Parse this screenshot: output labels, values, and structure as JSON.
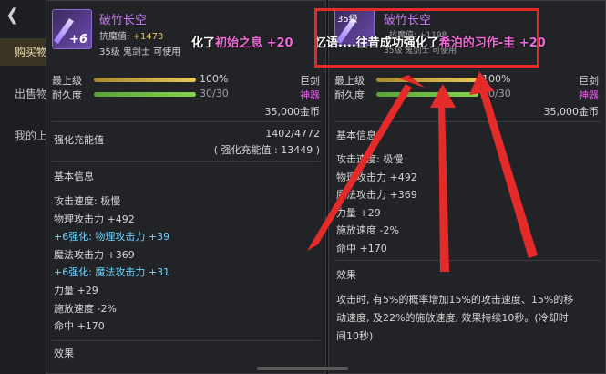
{
  "background": {
    "back_icon": "back-arrow-icon",
    "nav": [
      "购买物",
      "出售物",
      "我的上"
    ]
  },
  "left_panel": {
    "item_name": "破竹长空",
    "enhance": "+6",
    "resist_label": "抗魔值: ",
    "resist_value": "+1473",
    "level_class": "35级 鬼剑士 可使用",
    "max_level_label": "最上级",
    "max_level_value": "100%",
    "max_level_fill": 1.0,
    "durability_label": "耐久度",
    "durability_value": "30/30",
    "durability_fill": 1.0,
    "type": "巨剑",
    "grade": "神器",
    "price": "35,000金币",
    "enh_title": "强化充能值",
    "enh_value": "1402/4772",
    "enh_total": "( 强化充能值 : 13449 )",
    "basic_title": "基本信息",
    "stats": [
      {
        "text": "攻击速度: 极慢",
        "cls": ""
      },
      {
        "text": "物理攻击力 +492",
        "cls": ""
      },
      {
        "text": "+6强化: 物理攻击力 +39",
        "cls": "cyan"
      },
      {
        "text": "魔法攻击力 +369",
        "cls": ""
      },
      {
        "text": "+6强化: 魔法攻击力 +31",
        "cls": "cyan"
      },
      {
        "text": "力量 +29",
        "cls": ""
      },
      {
        "text": "施放速度 -2%",
        "cls": ""
      },
      {
        "text": "命中 +170",
        "cls": ""
      }
    ],
    "bottom_title": "效果"
  },
  "right_panel": {
    "icon_level": "35级",
    "item_name": "破竹长空",
    "sub_a": "抗魔值: +1198",
    "sub_b": "35级 鬼剑士 可使用",
    "max_level_label": "最上级",
    "max_level_value": "100%",
    "max_level_fill": 1.0,
    "durability_label": "耐久度",
    "durability_value": "30/30",
    "durability_fill": 1.0,
    "type": "巨剑",
    "grade": "神器",
    "price": "35,000金币",
    "basic_title": "基本信息",
    "stats": [
      "攻击速度: 极慢",
      "物理攻击力 +492",
      "魔法攻击力 +369",
      "力量 +29",
      "施放速度 -2%",
      "命中 +170"
    ],
    "effect_title": "效果",
    "effect_lines": [
      "攻击时, 有5%的概率增加15%的攻击速度、15%的移",
      "动速度, 及22%的施放速度, 效果持续10秒。(冷却时",
      "间10秒)"
    ]
  },
  "notices": {
    "n1_prefix": "化了",
    "n1_item": "初始之息",
    "n1_value": "+20",
    "n2_prefix": "忆语....往昔成功强化了",
    "n2_item": "希泊的习作-圭",
    "n2_value": "+20"
  },
  "colors": {
    "annotation_red": "#e52a2a",
    "item_name": "#c57bf2",
    "enhance_stat": "#6fd3ff",
    "grade": "#e262e6"
  }
}
